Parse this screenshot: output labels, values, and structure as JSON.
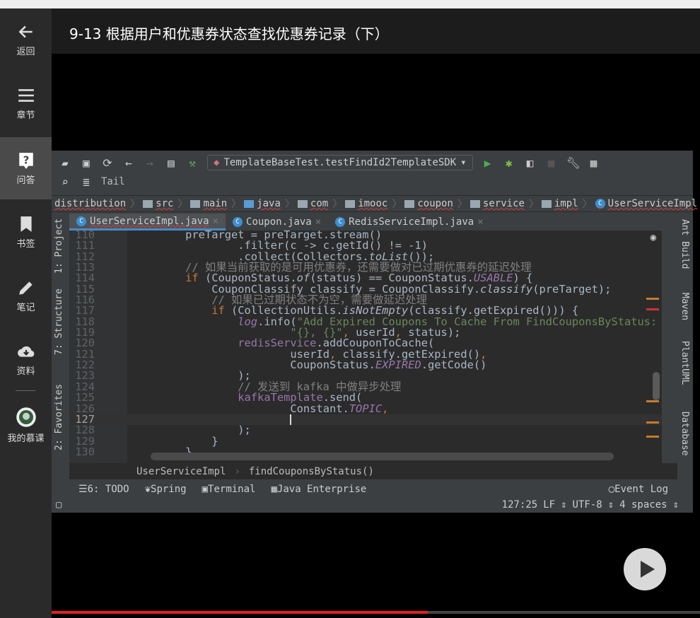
{
  "title": "9-13 根据用户和优惠券状态查找优惠券记录（下）",
  "sidebar": {
    "items": [
      {
        "label": "返回",
        "icon": "arrow-left-icon"
      },
      {
        "label": "章节",
        "icon": "menu-icon"
      },
      {
        "label": "问答",
        "icon": "question-icon",
        "active": true
      },
      {
        "label": "书签",
        "icon": "bookmark-icon"
      },
      {
        "label": "笔记",
        "icon": "pencil-icon"
      },
      {
        "label": "资料",
        "icon": "cloud-download-icon"
      },
      {
        "label": "我的慕课",
        "icon": "avatar"
      }
    ]
  },
  "ide": {
    "run_config": "TemplateBaseTest.testFindId2TemplateSDK",
    "tail_label": "Tail",
    "breadcrumbs": [
      "distribution",
      "src",
      "main",
      "java",
      "com",
      "imooc",
      "coupon",
      "service",
      "impl",
      "UserServiceImpl"
    ],
    "tabs": [
      {
        "label": "UserServiceImpl.java",
        "active": true
      },
      {
        "label": "Coupon.java"
      },
      {
        "label": "RedisServiceImpl.java"
      }
    ],
    "left_tools": [
      "1: Project",
      "7: Structure",
      "2: Favorites"
    ],
    "right_tools": [
      "Ant Build",
      "Maven",
      "PlantUML",
      "Database"
    ],
    "current_line": 127,
    "code": [
      {
        "n": "110",
        "s": [
          [
            "pl",
            "        preTarget = preTarget.stream()"
          ]
        ]
      },
      {
        "n": "111",
        "s": [
          [
            "pl",
            "                .filter(c -> c.getId() != -1)"
          ]
        ]
      },
      {
        "n": "112",
        "s": [
          [
            "pl",
            "                .collect(Collectors."
          ],
          [
            "it",
            "toList"
          ],
          [
            "pl",
            "());"
          ]
        ]
      },
      {
        "n": "113",
        "s": [
          [
            "cm",
            "        // 如果当前获取的是可用优惠券，还需要做对已过期优惠券的延迟处理"
          ]
        ]
      },
      {
        "n": "114",
        "s": [
          [
            "kw",
            "        if "
          ],
          [
            "pl",
            "(CouponStatus."
          ],
          [
            "it",
            "of"
          ],
          [
            "pl",
            "(status) == CouponStatus."
          ],
          [
            "itf",
            "USABLE"
          ],
          [
            "pl",
            ") {"
          ]
        ]
      },
      {
        "n": "115",
        "s": [
          [
            "pl",
            "            CouponClassify classify = CouponClassify."
          ],
          [
            "it",
            "classify"
          ],
          [
            "pl",
            "(preTarget);"
          ]
        ]
      },
      {
        "n": "116",
        "s": [
          [
            "cm",
            "            // 如果已过期状态不为空，需要做延迟处理"
          ]
        ]
      },
      {
        "n": "117",
        "s": [
          [
            "kw",
            "            if "
          ],
          [
            "pl",
            "(CollectionUtils."
          ],
          [
            "it",
            "isNotEmpty"
          ],
          [
            "pl",
            "(classify.getExpired())) {"
          ]
        ]
      },
      {
        "n": "118",
        "s": [
          [
            "pl",
            "                "
          ],
          [
            "itf",
            "log"
          ],
          [
            "pl",
            ".info("
          ],
          [
            "str",
            "\"Add Expired Coupons To Cache From FindCouponsByStatus: \""
          ],
          [
            "pl",
            " +"
          ]
        ]
      },
      {
        "n": "119",
        "s": [
          [
            "str",
            "                        \"{}, {}\""
          ],
          [
            "kw",
            ","
          ],
          [
            "pl",
            " userId"
          ],
          [
            "kw",
            ","
          ],
          [
            "pl",
            " status);"
          ]
        ]
      },
      {
        "n": "120",
        "s": [
          [
            "fld",
            "                redisService"
          ],
          [
            "pl",
            ".addCouponToCache("
          ]
        ]
      },
      {
        "n": "121",
        "s": [
          [
            "pl",
            "                        userId"
          ],
          [
            "kw",
            ","
          ],
          [
            "pl",
            " classify.getExpired()"
          ],
          [
            "kw",
            ","
          ]
        ]
      },
      {
        "n": "122",
        "s": [
          [
            "pl",
            "                        CouponStatus."
          ],
          [
            "itf",
            "EXPIRED"
          ],
          [
            "pl",
            ".getCode()"
          ]
        ]
      },
      {
        "n": "123",
        "s": [
          [
            "pl",
            "                );"
          ]
        ]
      },
      {
        "n": "124",
        "s": [
          [
            "cm",
            "                // 发送到 kafka 中做异步处理"
          ]
        ]
      },
      {
        "n": "125",
        "s": [
          [
            "fld",
            "                kafkaTemplate"
          ],
          [
            "pl",
            ".send("
          ]
        ]
      },
      {
        "n": "126",
        "s": [
          [
            "pl",
            "                        Constant."
          ],
          [
            "itf",
            "TOPIC"
          ],
          [
            "kw",
            ","
          ]
        ]
      },
      {
        "n": "127",
        "s": [
          [
            "pl",
            "                        "
          ]
        ]
      },
      {
        "n": "128",
        "s": [
          [
            "pl",
            "                );"
          ]
        ]
      },
      {
        "n": "129",
        "s": [
          [
            "pl",
            "            }"
          ]
        ]
      },
      {
        "n": "130",
        "s": [
          [
            "pl",
            "        }"
          ]
        ]
      }
    ],
    "nav_path": [
      "UserServiceImpl",
      "findCouponsByStatus()"
    ],
    "bottom_tools": [
      "6: TODO",
      "Spring",
      "Terminal",
      "Java Enterprise"
    ],
    "event_log": "Event Log",
    "status": {
      "position": "127:25",
      "line_sep": "LF",
      "encoding": "UTF-8",
      "indent": "4 spaces"
    }
  },
  "video_progress": 0.58
}
